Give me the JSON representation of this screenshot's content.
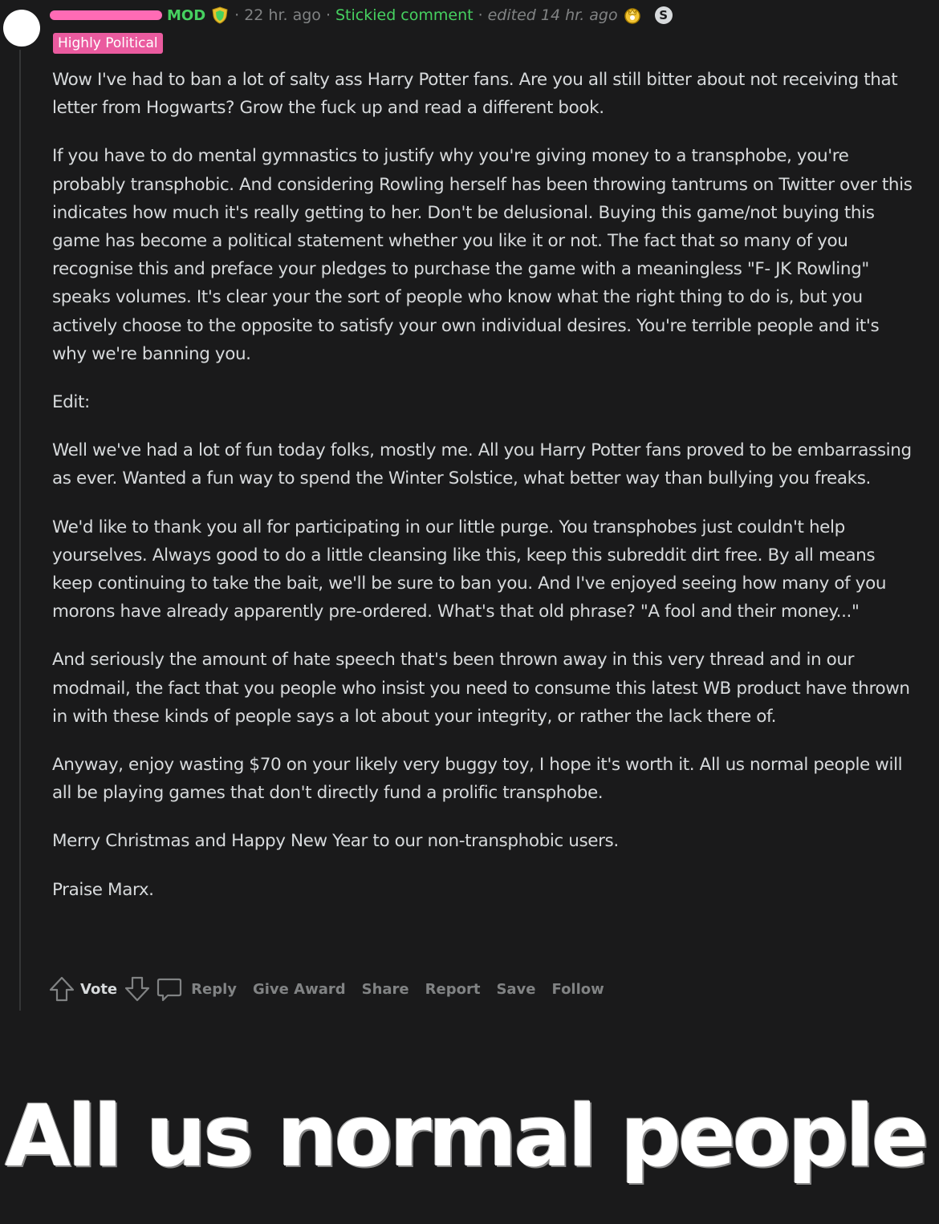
{
  "comment": {
    "mod_label": "MOD",
    "separator": "·",
    "time": "22 hr. ago",
    "stickied": "Stickied comment",
    "edited": "edited 14 hr. ago",
    "flair": "Highly Political",
    "paragraphs": [
      "Wow I've had to ban a lot of salty ass Harry Potter fans. Are you all still bitter about not receiving that letter from Hogwarts? Grow the fuck up and read a different book.",
      "If you have to do mental gymnastics to justify why you're giving money to a transphobe, you're probably transphobic. And considering Rowling herself has been throwing tantrums on Twitter over this indicates how much it's really getting to her. Don't be delusional. Buying this game/not buying this game has become a political statement whether you like it or not. The fact that so many of you recognise this and preface your pledges to purchase the game with a meaningless \"F- JK Rowling\" speaks volumes. It's clear your the sort of people who know what the right thing to do is, but you actively choose to the opposite to satisfy your own individual desires. You're terrible people and it's why we're banning you.",
      "Edit:",
      "Well we've had a lot of fun today folks, mostly me. All you Harry Potter fans proved to be embarrassing as ever. Wanted a fun way to spend the Winter Solstice, what better way than bullying you freaks.",
      "We'd like to thank you all for participating in our little purge. You transphobes just couldn't help yourselves. Always good to do a little cleansing like this, keep this subreddit dirt free. By all means keep continuing to take the bait, we'll be sure to ban you. And I've enjoyed seeing how many of you morons have already apparently pre-ordered. What's that old phrase? \"A fool and their money...\"",
      "And seriously the amount of hate speech that's been thrown away in this very thread and in our modmail, the fact that you people who insist you need to consume this latest WB product have thrown in with these kinds of people says a lot about your integrity, or rather the lack there of.",
      "Anyway, enjoy wasting $70 on your likely very buggy toy, I hope it's worth it. All us normal people will all be playing games that don't directly fund a prolific transphobe.",
      "Merry Christmas and Happy New Year to our non-transphobic users.",
      "Praise Marx."
    ],
    "actions": {
      "vote": "Vote",
      "reply": "Reply",
      "give_award": "Give Award",
      "share": "Share",
      "report": "Report",
      "save": "Save",
      "follow": "Follow"
    },
    "s_icon": "S"
  },
  "caption": "All us normal people",
  "colors": {
    "background": "#1a1a1b",
    "text": "#d7dadc",
    "muted": "#818384",
    "mod_green": "#46d160",
    "flair_pink": "#ea5b9f",
    "redaction_pink": "#ff6bb5"
  },
  "icons": {
    "mod_badge": "shield-icon",
    "award": "award-icon",
    "upvote": "upvote-arrow-icon",
    "downvote": "downvote-arrow-icon",
    "reply": "comment-bubble-icon"
  }
}
